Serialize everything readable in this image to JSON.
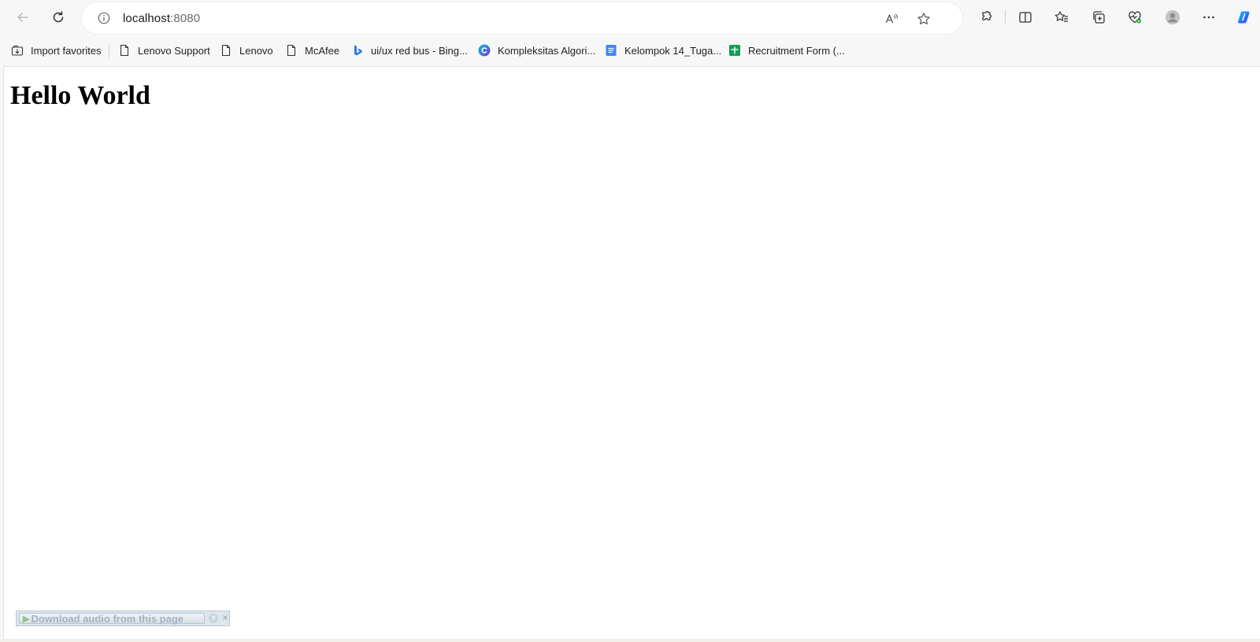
{
  "browser": {
    "address_bar": {
      "host": "localhost",
      "port": ":8080"
    },
    "icons": {
      "back": "back-arrow-icon",
      "refresh": "refresh-icon",
      "site_info": "info-icon",
      "read_aloud": "read-aloud-icon",
      "favorite": "star-icon",
      "extensions": "puzzle-icon",
      "split_screen": "split-screen-icon",
      "favorites_list": "favorites-list-icon",
      "collections": "collections-icon",
      "browser_essentials": "heart-pulse-icon",
      "profile": "profile-avatar-icon",
      "more": "more-dots-icon",
      "copilot": "copilot-icon"
    }
  },
  "favorites_bar": {
    "items": [
      {
        "label": "Import favorites",
        "icon": "import-icon"
      },
      {
        "label": "Lenovo Support",
        "icon": "page-icon"
      },
      {
        "label": "Lenovo",
        "icon": "page-icon"
      },
      {
        "label": "McAfee",
        "icon": "page-icon"
      },
      {
        "label": "ui/ux red bus - Bing...",
        "icon": "bing-icon"
      },
      {
        "label": "Kompleksitas Algori...",
        "icon": "canva-icon"
      },
      {
        "label": "Kelompok 14_Tuga...",
        "icon": "google-docs-icon"
      },
      {
        "label": "Recruitment Form (...",
        "icon": "google-sheets-icon"
      }
    ]
  },
  "page": {
    "heading": "Hello World"
  },
  "download_widget": {
    "label": "Download audio from this page",
    "help": "?",
    "close": "×"
  },
  "colors": {
    "chrome_bg": "#f7f7f7",
    "page_bg": "#ffffff",
    "copilot_blue": "#1e8fff",
    "docs_blue": "#4285f4",
    "sheets_green": "#0f9d58",
    "bing_blue": "#2d7de0"
  }
}
